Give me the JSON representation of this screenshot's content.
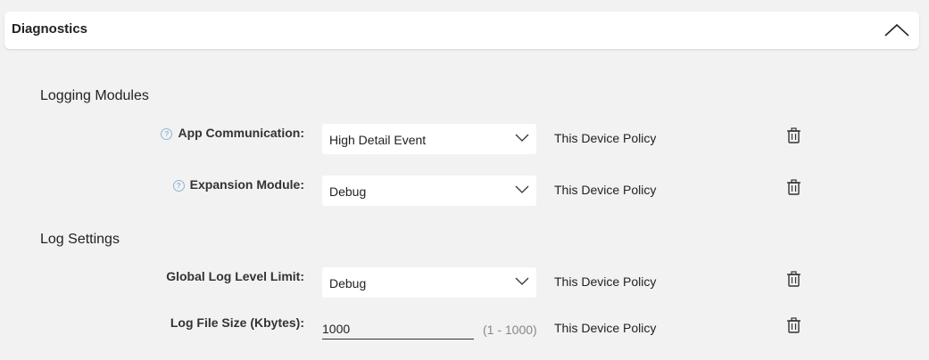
{
  "panel": {
    "title": "Diagnostics",
    "collapse_icon": "chevron-up-icon"
  },
  "logging_modules": {
    "title": "Logging Modules",
    "rows": [
      {
        "label": "App Communication:",
        "value": "High Detail Event",
        "policy": "This Device Policy",
        "has_help": true
      },
      {
        "label": "Expansion Module:",
        "value": "Debug",
        "policy": "This Device Policy",
        "has_help": true
      }
    ]
  },
  "log_settings": {
    "title": "Log Settings",
    "global_level": {
      "label": "Global Log Level Limit:",
      "value": "Debug",
      "policy": "This Device Policy"
    },
    "file_size": {
      "label": "Log File Size (Kbytes):",
      "value": "1000",
      "range_hint": "(1 - 1000)",
      "policy": "This Device Policy"
    }
  },
  "colors": {
    "background": "#f2f2f2",
    "panel": "#ffffff",
    "help_icon": "#8fb4d8"
  }
}
